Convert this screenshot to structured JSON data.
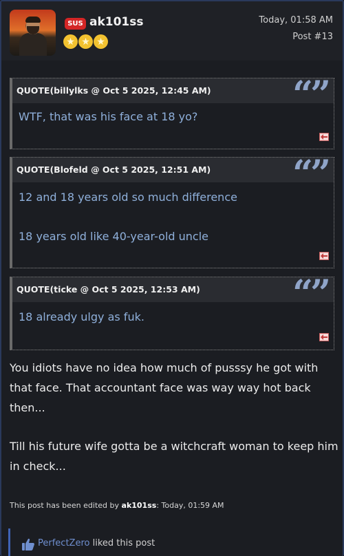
{
  "post": {
    "author": "ak101ss",
    "badge": "SUS",
    "rank_stars": 3,
    "time": "Today, 01:58 AM",
    "number": "Post #13"
  },
  "quotes": [
    {
      "title": "QUOTE(billylks @ Oct 5 2025, 12:45 AM)",
      "lines": [
        "WTF, that was his face at 18 yo?"
      ]
    },
    {
      "title": "QUOTE(Blofeld @ Oct 5 2025, 12:51 AM)",
      "lines": [
        "12 and 18 years old so much difference",
        "18 years old like 40-year-old uncle"
      ]
    },
    {
      "title": "QUOTE(ticke @ Oct 5 2025, 12:53 AM)",
      "lines": [
        "18 already ulgy as fuk."
      ]
    }
  ],
  "body": {
    "paragraph1": [
      "You idiots have no idea how much of pusssy he got with",
      "that face. That accountant face was way way hot back",
      "then..."
    ],
    "paragraph2": [
      "Till his future wife gotta be a witchcraft woman to keep him",
      "in check..."
    ]
  },
  "edit": {
    "prefix": "This post has been edited by ",
    "user": "ak101ss",
    "suffix": ": Today, 01:59 AM"
  },
  "likes": {
    "user": "PerfectZero",
    "text": " liked this post"
  },
  "colors": {
    "background": "#1b1d22",
    "quote_text": "#8fb0db",
    "badge": "#d42626",
    "star": "#f2c230",
    "like_user": "#6f8fcf"
  },
  "icons": {
    "quote_marks": "quote-marks-icon",
    "back": "back-arrow-icon",
    "star": "star-icon",
    "like": "thumbs-up-icon"
  }
}
